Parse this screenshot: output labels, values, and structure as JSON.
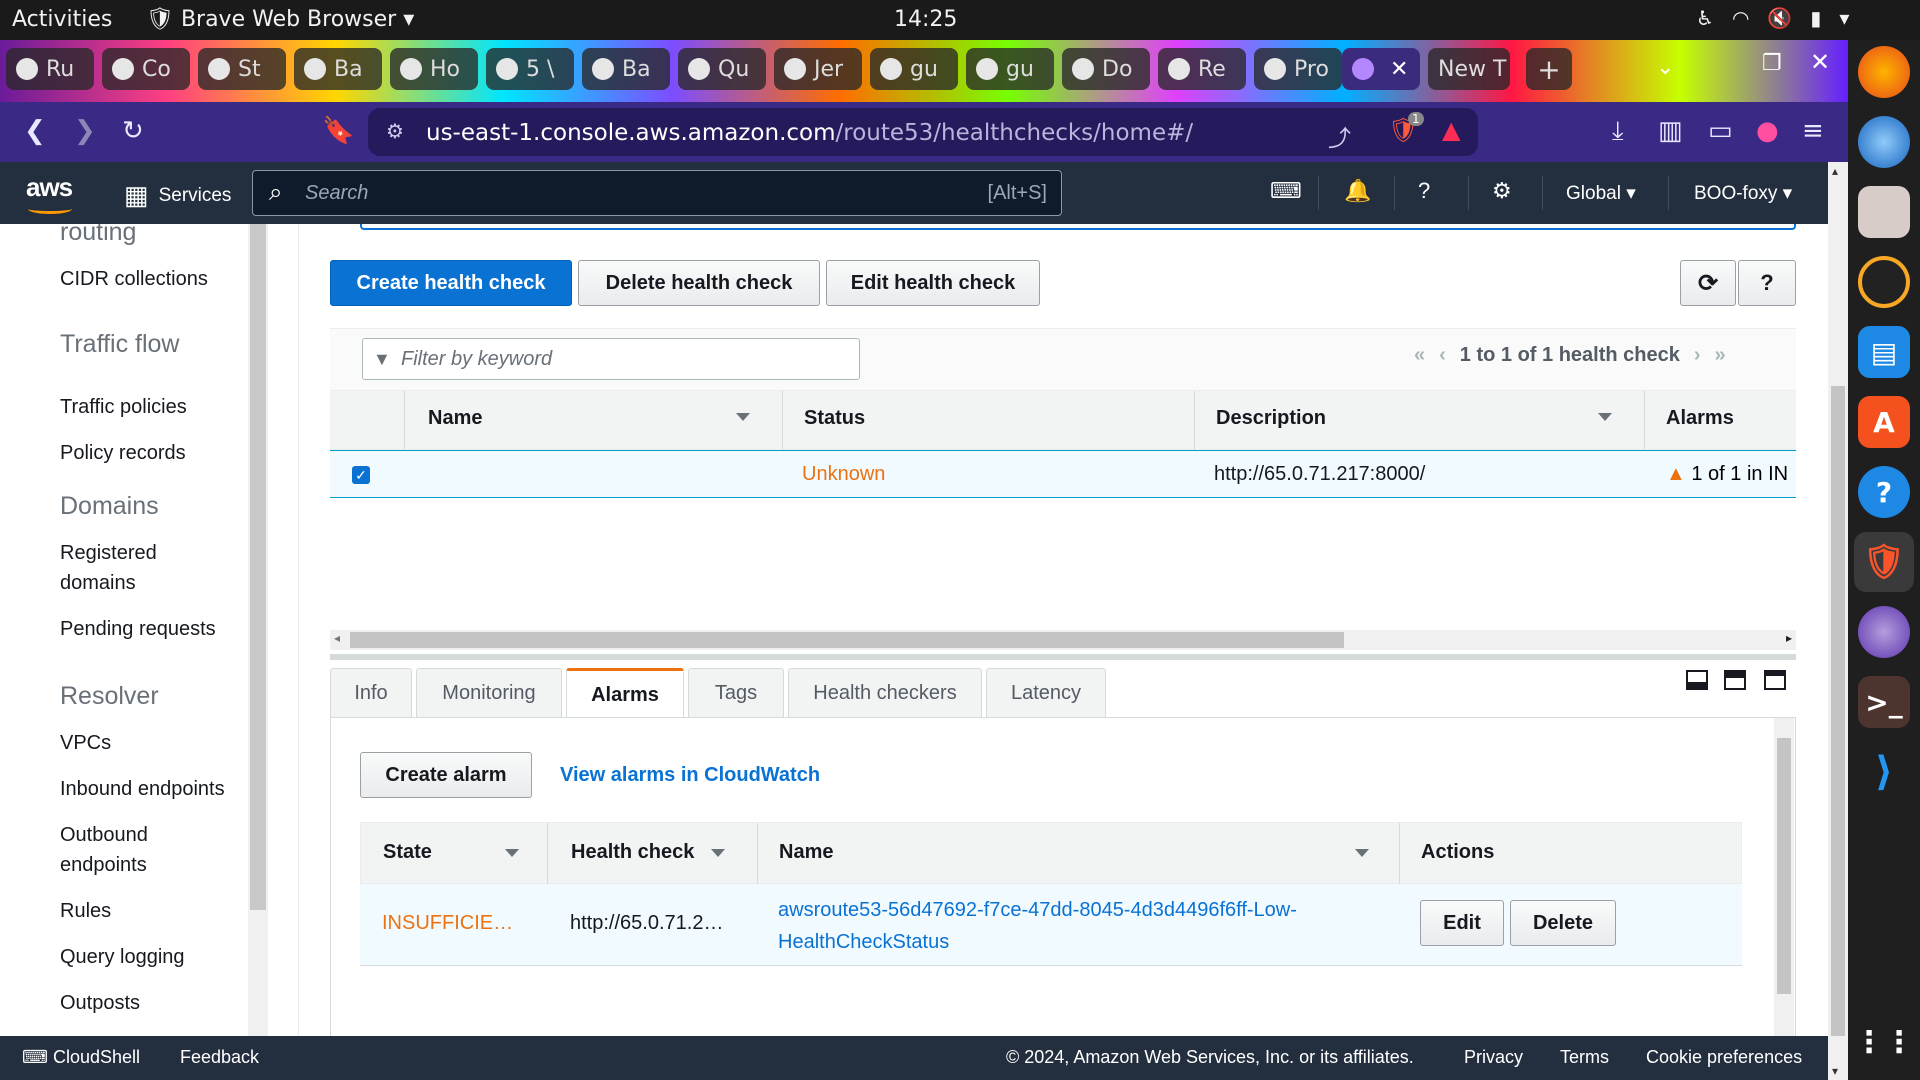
{
  "os": {
    "activities": "Activities",
    "app_name": "Brave Web Browser",
    "clock": "14:25"
  },
  "browser": {
    "tabs": [
      {
        "label": "Ru"
      },
      {
        "label": "Co"
      },
      {
        "label": "St"
      },
      {
        "label": "Ba"
      },
      {
        "label": "Ho"
      },
      {
        "label": "5 \\"
      },
      {
        "label": "Ba"
      },
      {
        "label": "Qu"
      },
      {
        "label": "Jer"
      },
      {
        "label": "gu"
      },
      {
        "label": "gu"
      },
      {
        "label": "Do"
      },
      {
        "label": "Re"
      },
      {
        "label": "Pro"
      },
      {
        "label": "",
        "active": true
      },
      {
        "label": "New T"
      }
    ],
    "url_host": "us-east-1.console.aws.amazon.com",
    "url_path": "/route53/healthchecks/home#/",
    "shield_badge": "1"
  },
  "aws_nav": {
    "logo": "aws",
    "services": "Services",
    "search_placeholder": "Search",
    "search_shortcut": "[Alt+S]",
    "region": "Global",
    "account": "BOO-foxy"
  },
  "sidebar": {
    "partial_heading": "routing",
    "cidr": "CIDR collections",
    "traffic_flow_heading": "Traffic flow",
    "traffic_policies": "Traffic policies",
    "policy_records": "Policy records",
    "domains_heading": "Domains",
    "registered_domains_1": "Registered",
    "registered_domains_2": "domains",
    "pending_requests": "Pending requests",
    "resolver_heading": "Resolver",
    "vpcs": "VPCs",
    "inbound": "Inbound endpoints",
    "outbound_1": "Outbound",
    "outbound_2": "endpoints",
    "rules": "Rules",
    "query_logging": "Query logging",
    "outposts": "Outposts"
  },
  "actions": {
    "create": "Create health check",
    "delete": "Delete health check",
    "edit": "Edit health check"
  },
  "table": {
    "filter_placeholder": "Filter by keyword",
    "pagination": "1 to 1 of 1 health check",
    "columns": {
      "name": "Name",
      "status": "Status",
      "description": "Description",
      "alarms": "Alarms"
    },
    "rows": [
      {
        "name": "",
        "status": "Unknown",
        "description": "http://65.0.71.217:8000/",
        "alarms": "1 of 1 in IN"
      }
    ]
  },
  "details": {
    "tabs": [
      "Info",
      "Monitoring",
      "Alarms",
      "Tags",
      "Health checkers",
      "Latency"
    ],
    "active_tab": "Alarms",
    "create_alarm": "Create alarm",
    "view_alarms": "View alarms in CloudWatch",
    "alarm_columns": {
      "state": "State",
      "health_check": "Health check",
      "name": "Name",
      "actions": "Actions"
    },
    "alarm_rows": [
      {
        "state": "INSUFFICIE…",
        "health_check": "http://65.0.71.2…",
        "name_line1": "awsroute53-56d47692-f7ce-47dd-8045-4d3d4496f6ff-Low-",
        "name_line2": "HealthCheckStatus",
        "edit": "Edit",
        "delete": "Delete"
      }
    ]
  },
  "footer": {
    "cloudshell": "CloudShell",
    "feedback": "Feedback",
    "copyright": "© 2024, Amazon Web Services, Inc. or its affiliates.",
    "privacy": "Privacy",
    "terms": "Terms",
    "cookies": "Cookie preferences"
  },
  "colors": {
    "primary": "#0972d3",
    "warning": "#ec7211",
    "aws_nav": "#232f3e",
    "browser_bar": "#3a2a86"
  }
}
